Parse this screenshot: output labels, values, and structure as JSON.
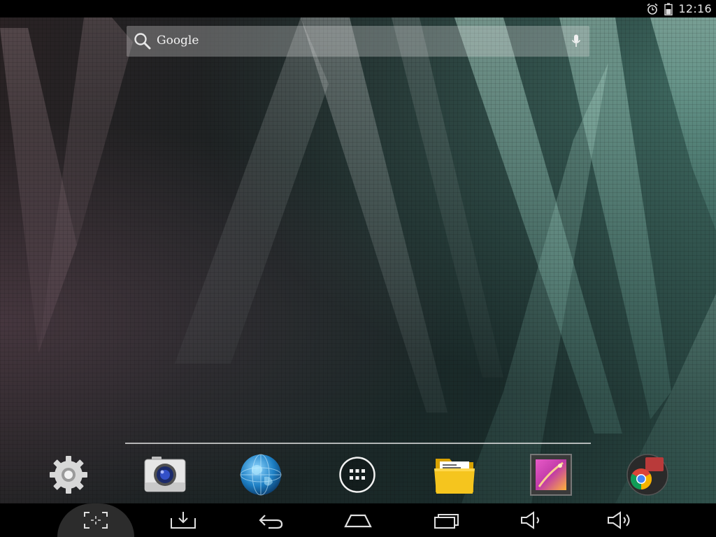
{
  "status_bar": {
    "time": "12:16",
    "icons": [
      "alarm-icon",
      "battery-icon"
    ]
  },
  "search": {
    "label": "Google",
    "icons": [
      "search-icon",
      "microphone-icon"
    ]
  },
  "dock": {
    "apps": [
      {
        "name": "settings",
        "icon": "gear-icon"
      },
      {
        "name": "camera",
        "icon": "camera-icon"
      },
      {
        "name": "browser",
        "icon": "globe-icon"
      },
      {
        "name": "all-apps",
        "icon": "app-drawer-icon"
      },
      {
        "name": "file-manager",
        "icon": "folder-icon"
      },
      {
        "name": "gallery",
        "icon": "gallery-icon"
      },
      {
        "name": "chrome",
        "icon": "chrome-icon"
      }
    ]
  },
  "nav_bar": {
    "buttons": [
      "screenshot-icon",
      "download-icon",
      "back-icon",
      "home-icon",
      "recent-apps-icon",
      "volume-down-icon",
      "volume-up-icon"
    ]
  },
  "colors": {
    "status_bar": "#000000",
    "nav_bar": "#000000",
    "search_bar": "#e1e1e14d",
    "wallpaper_teal": "#7fc8b8"
  }
}
